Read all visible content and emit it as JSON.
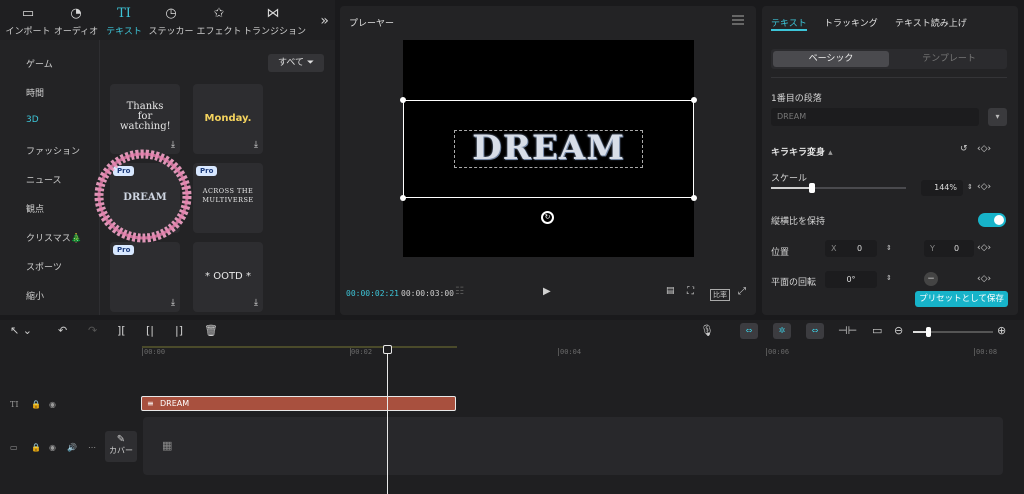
{
  "toolbar": {
    "tabs": [
      {
        "label": "インポート",
        "icon": "import-icon"
      },
      {
        "label": "オーディオ",
        "icon": "audio-icon"
      },
      {
        "label": "テキスト",
        "icon": "text-icon",
        "active": true
      },
      {
        "label": "ステッカー",
        "icon": "sticker-icon"
      },
      {
        "label": "エフェクト",
        "icon": "effects-icon"
      },
      {
        "label": "トランジション",
        "icon": "transition-icon"
      }
    ],
    "more_glyph": "»"
  },
  "left": {
    "categories": [
      "ゲーム",
      "時間",
      "3D",
      "ファッション",
      "ニュース",
      "観点",
      "クリスマス🎄",
      "スポーツ",
      "縮小"
    ],
    "active_category": "3D",
    "filter_label": "すべて",
    "cards": [
      {
        "text": "Thanks for watching!"
      },
      {
        "text": "Monday."
      },
      {
        "text": "DREAM",
        "pro": "Pro"
      },
      {
        "text": "ACROSS THE MULTIVERSE",
        "pro": "Pro"
      },
      {
        "text": "",
        "pro": "Pro"
      },
      {
        "text": "* OOTD *"
      }
    ]
  },
  "player": {
    "title": "プレーヤー",
    "preview_text": "DREAM",
    "current_time": "00:00:02:21",
    "total_time": "00:00:03:00",
    "ratio_label": "比率"
  },
  "right": {
    "tabs": [
      "テキスト",
      "トラッキング",
      "テキスト読み上げ"
    ],
    "active_tab": "テキスト",
    "seg_basic": "ベーシック",
    "seg_template": "テンプレート",
    "paragraph_label": "1番目の段落",
    "paragraph_value": "DREAM",
    "effect_label": "キラキラ変身",
    "scale_label": "スケール",
    "scale_value": "144%",
    "scale_fraction": 0.3,
    "keep_ratio_label": "縦横比を保持",
    "position_label": "位置",
    "pos_x_label": "X",
    "pos_x_value": "0",
    "pos_y_label": "Y",
    "pos_y_value": "0",
    "rotation_label": "平面の回転",
    "rotation_value": "0°",
    "preset_button": "プリセットとして保存"
  },
  "timeline": {
    "ruler": [
      "00:00",
      "00:02",
      "00:04",
      "00:06",
      "00:08"
    ],
    "text_clip_label": "DREAM",
    "cover_label": "カバー"
  }
}
